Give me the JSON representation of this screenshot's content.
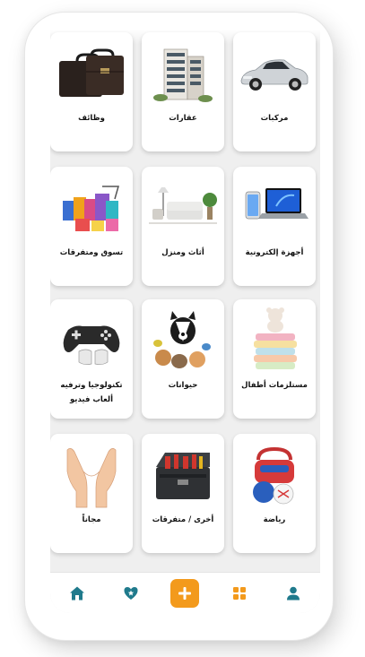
{
  "categories": [
    {
      "label": "مركبات",
      "image": "car-image"
    },
    {
      "label": "عقارات",
      "image": "building-image"
    },
    {
      "label": "وظائف",
      "image": "briefcase-image"
    },
    {
      "label": "أجهزة إلكترونية",
      "image": "laptop-phone-image"
    },
    {
      "label": "أثاث ومنزل",
      "image": "living-room-image"
    },
    {
      "label": "تسوق ومتفرقات",
      "image": "shopping-bags-image"
    },
    {
      "label": "مستلزمات أطفال",
      "image": "baby-items-image"
    },
    {
      "label": "حيوانات",
      "image": "pets-image"
    },
    {
      "label": "تكنولوجيا وترفيه",
      "label2": "ألعاب فيديو",
      "image": "gamepad-image"
    },
    {
      "label": "رياضة",
      "image": "sports-gear-image"
    },
    {
      "label": "أخرى / متفرقات",
      "image": "toolbox-image"
    },
    {
      "label": "مجاناً",
      "image": "open-hands-image"
    }
  ],
  "bottom_nav": {
    "items": [
      "profile-icon",
      "categories-icon",
      "add-icon",
      "favorites-icon",
      "home-icon"
    ],
    "active_color": "#1f7a8c",
    "add_color": "#f39a1c"
  },
  "colors": {
    "card_bg": "#ffffff",
    "screen_bg": "#efefef",
    "text": "#111111"
  }
}
